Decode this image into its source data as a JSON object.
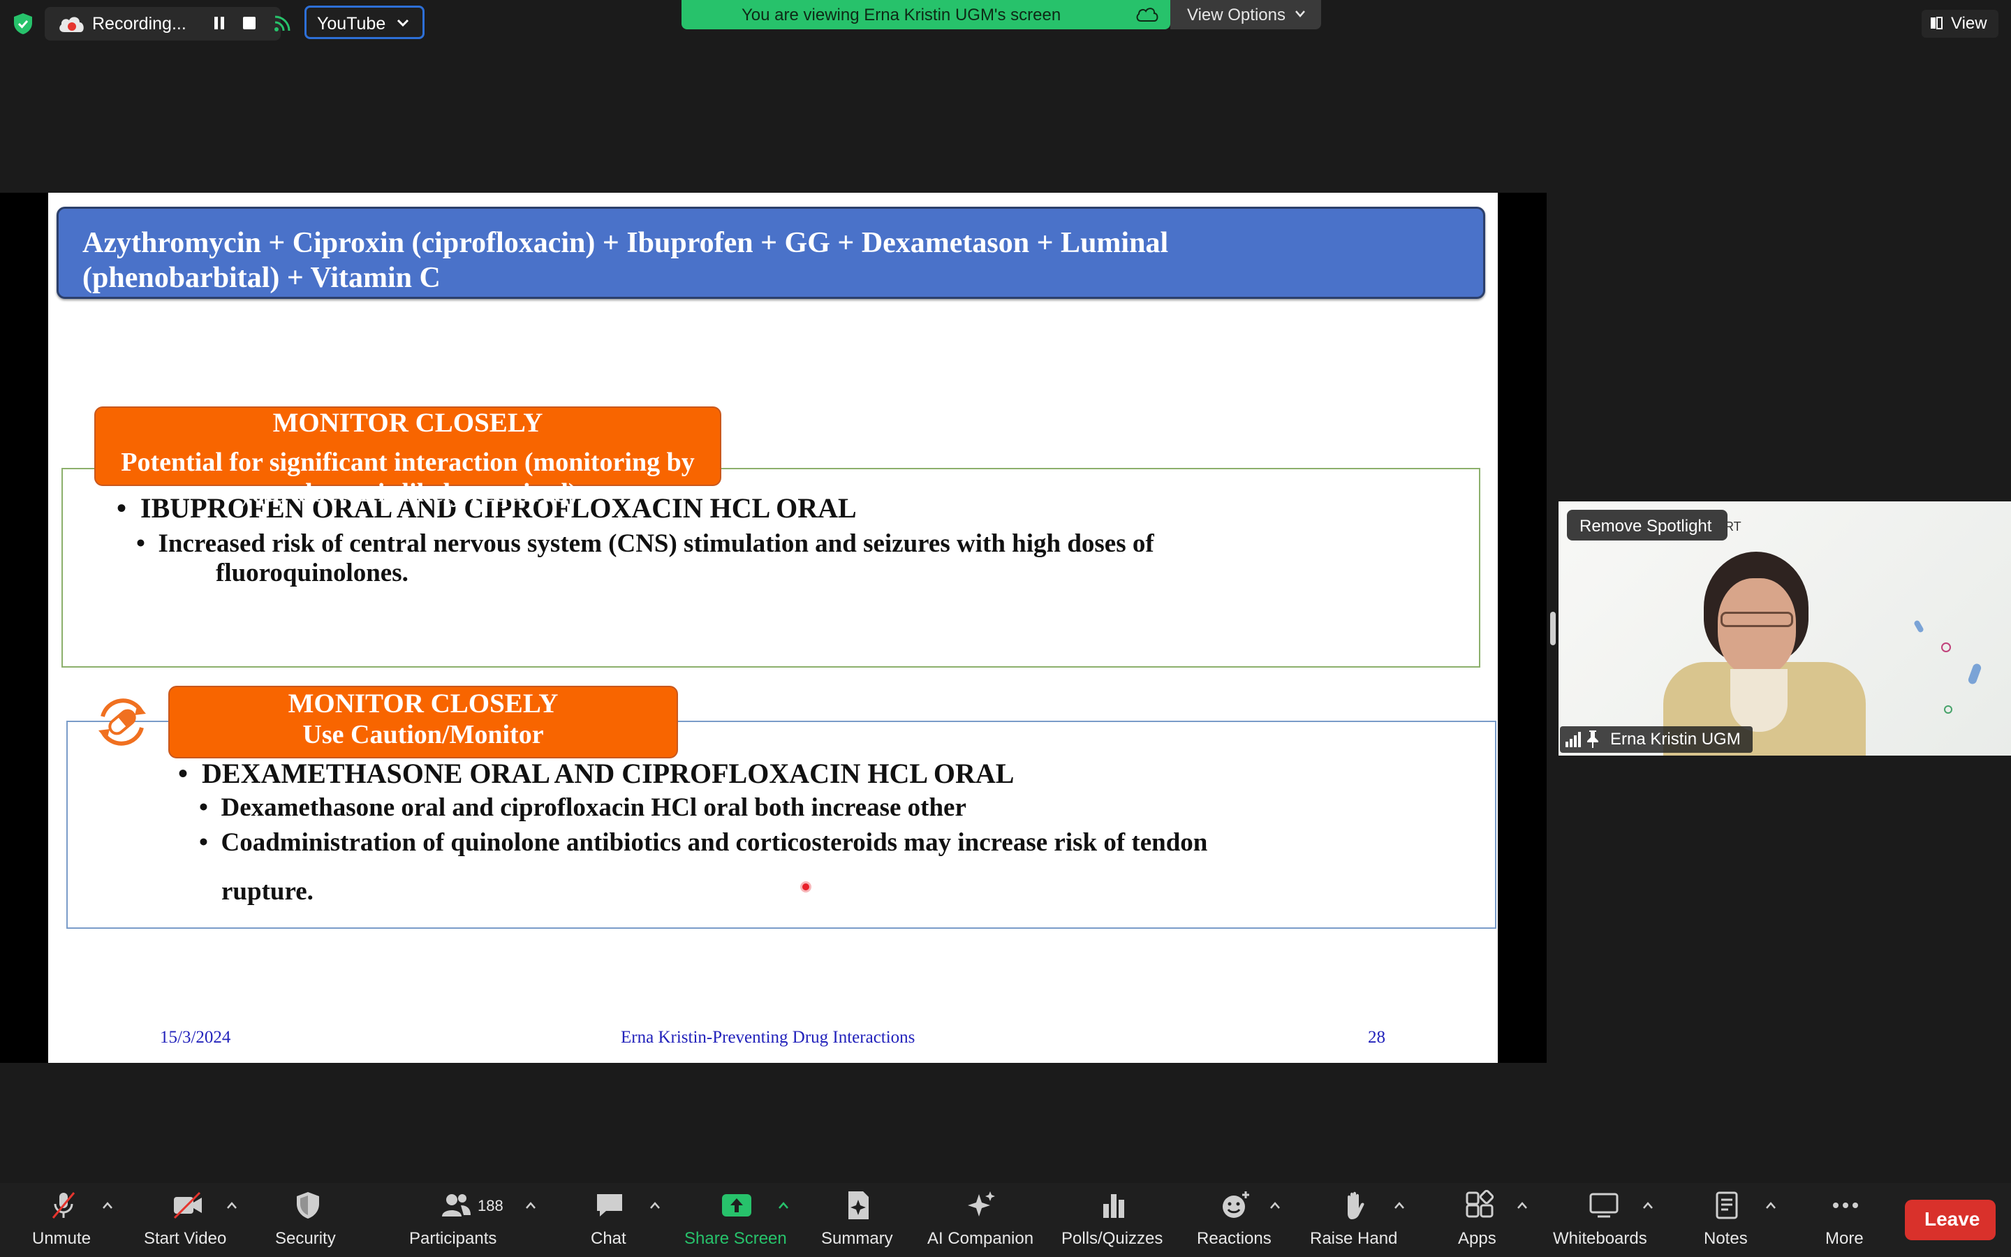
{
  "top_bar": {
    "recording_label": "Recording...",
    "stream_target": "YouTube",
    "viewing_banner": "You are viewing Erna Kristin UGM's screen",
    "view_options_label": "View Options",
    "view_label": "View"
  },
  "slide": {
    "title_line1": "Azythromycin + Ciproxin (ciprofloxacin) + Ibuprofen + GG + Dexametason + Luminal",
    "title_line2": "(phenobarbital) + Vitamin C",
    "section1": {
      "header": "MONITOR CLOSELY",
      "subheader": "Potential for significant interaction (monitoring by your doctor is likely required)",
      "bullet": "IBUPROFEN ORAL AND CIPROFLOXACIN HCL ORAL",
      "sub_bullet_line1": "Increased risk of central nervous system (CNS) stimulation and seizures with high doses of",
      "sub_bullet_line2": "fluoroquinolones."
    },
    "section2": {
      "header": "MONITOR CLOSELY",
      "subheader": "Use Caution/Monitor",
      "bullet": "DEXAMETHASONE ORAL AND CIPROFLOXACIN HCL ORAL",
      "sub_bullet1": "Dexamethasone oral and ciprofloxacin HCl oral both increase other",
      "sub_bullet2_line1": "Coadministration of quinolone antibiotics and corticosteroids may increase risk of tendon",
      "sub_bullet2_line2": "rupture."
    },
    "footer": {
      "date": "15/3/2024",
      "center": "Erna Kristin-Preventing Drug Interactions",
      "page": "28"
    },
    "colors": {
      "title_bg": "#4a72c9",
      "orange": "#f86500",
      "footer_text": "#2222bb"
    }
  },
  "video": {
    "spotlight_button": "Remove Spotlight",
    "participant_name": "Erna Kristin UGM",
    "background_text": "RT"
  },
  "toolbar": {
    "unmute": "Unmute",
    "start_video": "Start Video",
    "security": "Security",
    "participants": "Participants",
    "participants_count": "188",
    "chat": "Chat",
    "share_screen": "Share Screen",
    "summary": "Summary",
    "ai_companion": "AI Companion",
    "polls": "Polls/Quizzes",
    "reactions": "Reactions",
    "raise_hand": "Raise Hand",
    "apps": "Apps",
    "whiteboards": "Whiteboards",
    "notes": "Notes",
    "more": "More",
    "leave": "Leave",
    "share_color": "#27c26b",
    "leave_color": "#d9312b"
  }
}
